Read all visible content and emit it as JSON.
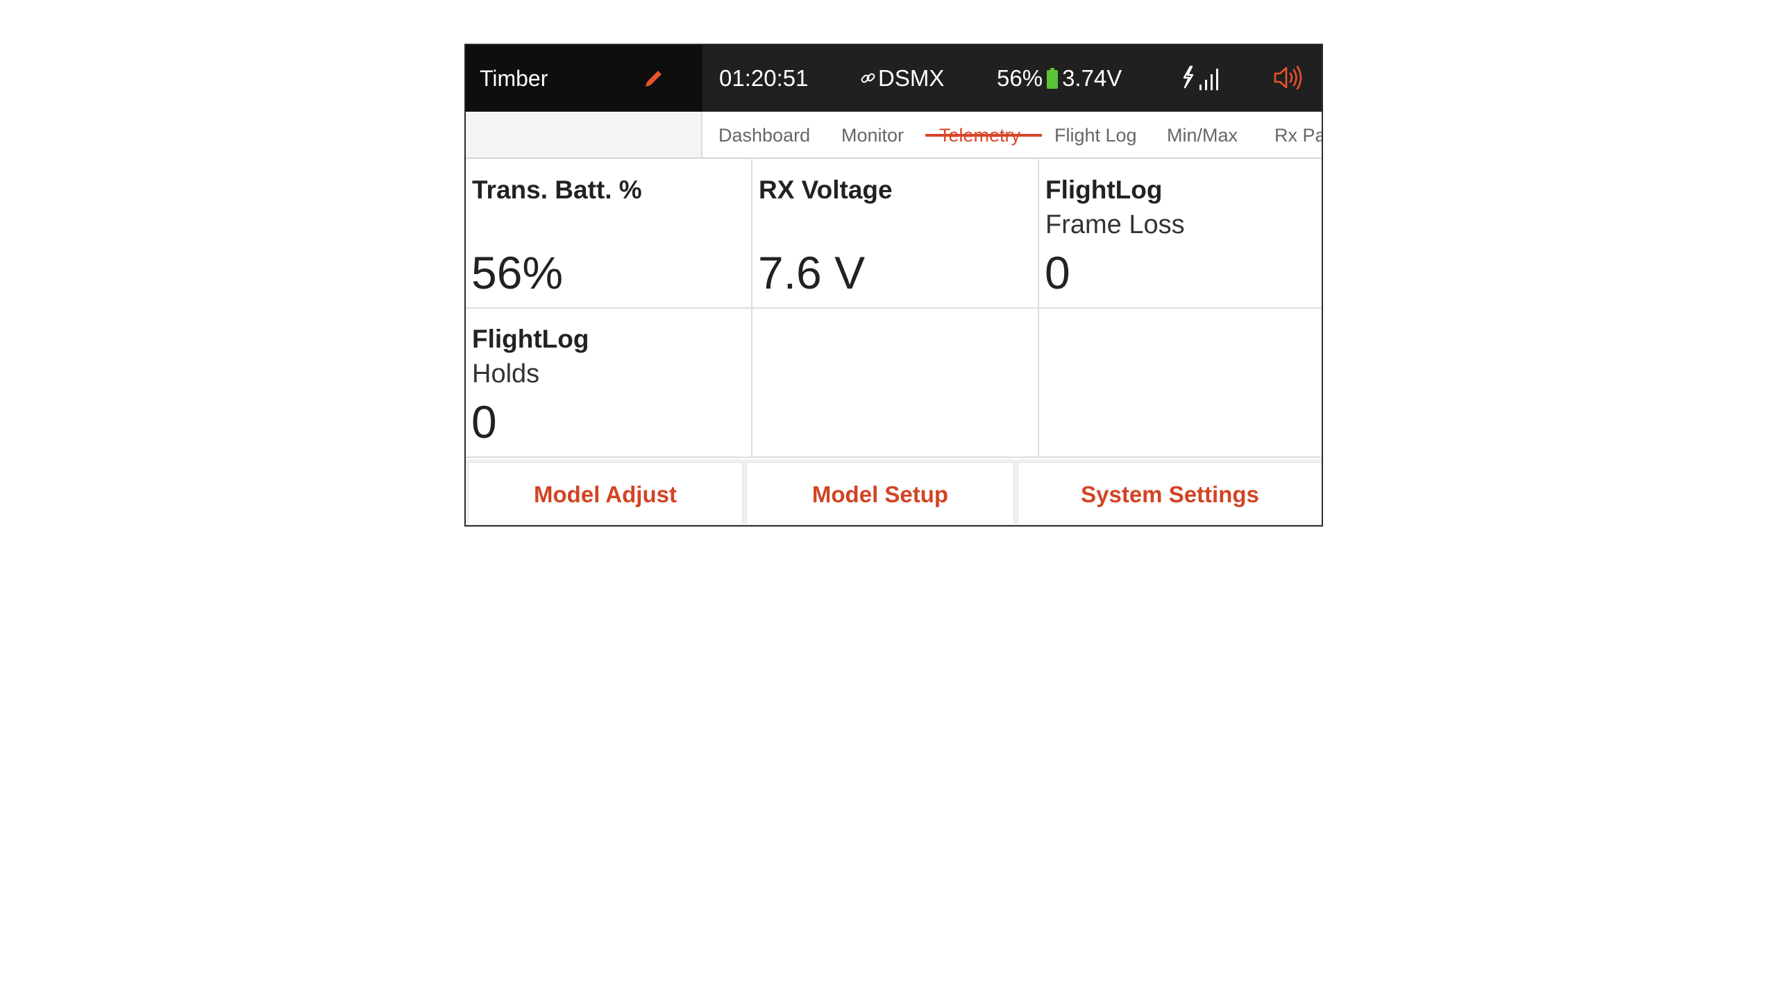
{
  "status_bar": {
    "model_name": "Timber",
    "timer": "01:20:51",
    "protocol": "DSMX",
    "battery_percent": "56%",
    "battery_voltage": "3.74V",
    "icons": [
      "edit-icon",
      "link-icon",
      "battery-icon",
      "signal-icon",
      "speaker-icon"
    ],
    "accent_color": "#e8542c",
    "battery_color": "#5cc338"
  },
  "tabs": [
    {
      "label": "Dashboard",
      "active": false
    },
    {
      "label": "Monitor",
      "active": false
    },
    {
      "label": "Telemetry",
      "active": true
    },
    {
      "label": "Flight Log",
      "active": false
    },
    {
      "label": "Min/Max",
      "active": false
    },
    {
      "label": "Rx Pa",
      "active": false
    }
  ],
  "telemetry": {
    "cells": [
      {
        "title": "Trans. Batt. %",
        "subtitle": "",
        "value": "56%"
      },
      {
        "title": "RX Voltage",
        "subtitle": "",
        "value": "7.6 V"
      },
      {
        "title": "FlightLog",
        "subtitle": "Frame Loss",
        "value": "0"
      },
      {
        "title": "FlightLog",
        "subtitle": "Holds",
        "value": "0"
      },
      {
        "title": "",
        "subtitle": "",
        "value": ""
      },
      {
        "title": "",
        "subtitle": "",
        "value": ""
      }
    ]
  },
  "bottom_buttons": {
    "model_adjust": "Model Adjust",
    "model_setup": "Model Setup",
    "system_settings": "System Settings",
    "label_color": "#d14424"
  }
}
